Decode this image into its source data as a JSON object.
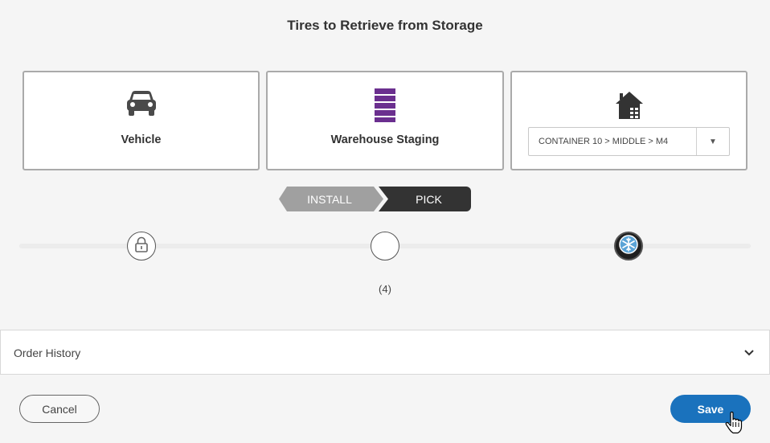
{
  "page": {
    "title": "Tires to Retrieve from Storage"
  },
  "locations": {
    "vehicle_label": "Vehicle",
    "warehouse_label": "Warehouse Staging",
    "storage_select_value": "CONTAINER 10 > MIDDLE > M4",
    "storage_select_arrow": "▼"
  },
  "mode_toggle": {
    "install_label": "INSTALL",
    "pick_label": "PICK",
    "selected": "PICK"
  },
  "tracker": {
    "count_label": "(4)",
    "nodes": [
      "lock-icon",
      "empty-circle",
      "snowflake-tire-icon"
    ]
  },
  "order_history": {
    "label": "Order History"
  },
  "actions": {
    "cancel_label": "Cancel",
    "save_label": "Save"
  },
  "colors": {
    "accent_blue": "#1a72bd",
    "warehouse_purple": "#6b2f8f",
    "dark": "#333333"
  }
}
